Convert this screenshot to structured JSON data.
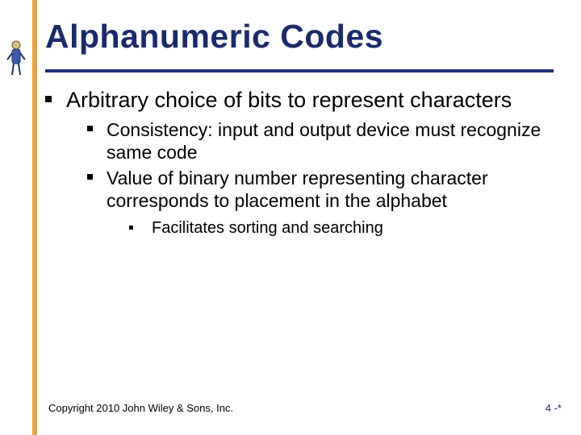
{
  "title": "Alphanumeric Codes",
  "bullets": {
    "l1": "Arbitrary choice of bits to represent characters",
    "l2a": "Consistency: input and output device must recognize same code",
    "l2b": "Value of binary number representing character corresponds to placement in the alphabet",
    "l3": "Facilitates sorting and searching"
  },
  "footer": "Copyright 2010 John Wiley & Sons, Inc.",
  "slidenum": "4 -*"
}
